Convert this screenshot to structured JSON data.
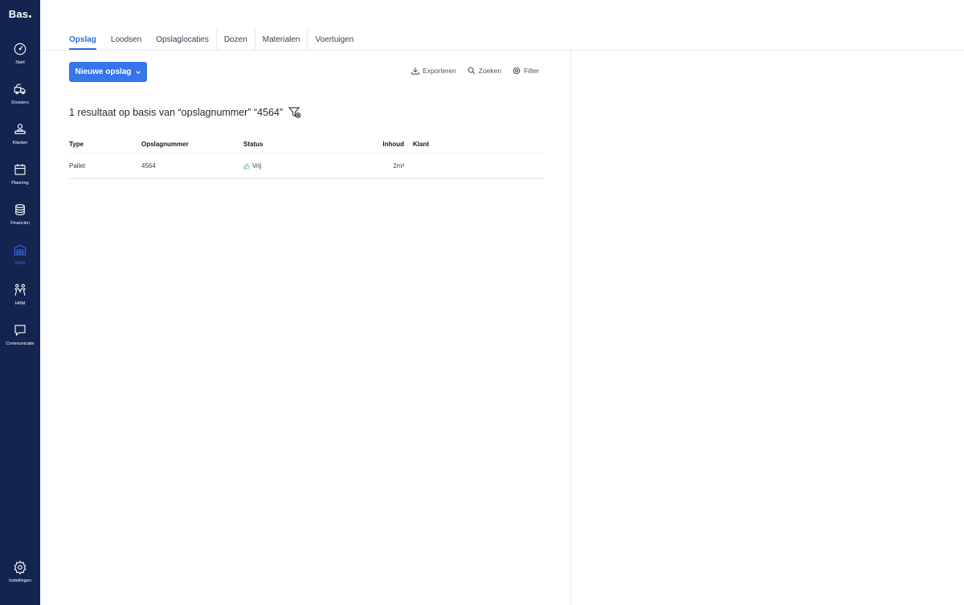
{
  "app": {
    "logo": "Bas"
  },
  "sidebar": {
    "items": [
      {
        "label": "Start",
        "icon": "gauge-icon"
      },
      {
        "label": "Dossiers",
        "icon": "truck-icon"
      },
      {
        "label": "Klanten",
        "icon": "clients-icon"
      },
      {
        "label": "Planning",
        "icon": "calendar-icon"
      },
      {
        "label": "Financiën",
        "icon": "coins-icon"
      },
      {
        "label": "WMS",
        "icon": "warehouse-icon",
        "active": true
      },
      {
        "label": "HRM",
        "icon": "people-icon"
      },
      {
        "label": "Communicatie",
        "icon": "chat-icon"
      }
    ],
    "settings": {
      "label": "Instellingen",
      "icon": "gear-icon"
    }
  },
  "tabs": [
    {
      "label": "Opslag",
      "active": true
    },
    {
      "label": "Loodsen"
    },
    {
      "label": "Opslaglocaties"
    },
    {
      "label": "Dozen"
    },
    {
      "label": "Materialen"
    },
    {
      "label": "Voertuigen"
    }
  ],
  "toolbar": {
    "new_button": "Nieuwe opslag",
    "export": "Exporteren",
    "search": "Zoeken",
    "filter": "Filter"
  },
  "results": {
    "summary": "1 resultaat op basis van “opslagnummer” “4564”"
  },
  "table": {
    "headers": {
      "type": "Type",
      "number": "Opslagnummer",
      "status": "Status",
      "content": "Inhoud",
      "client": "Klant"
    },
    "rows": [
      {
        "type": "Pallet",
        "number": "4564",
        "status": "Vrij",
        "content": "2m³",
        "client": ""
      }
    ]
  },
  "colors": {
    "sidebar": "#12244f",
    "accent": "#3675ea",
    "active_nav": "#3f6ad8",
    "status_free": "#86c79a"
  }
}
